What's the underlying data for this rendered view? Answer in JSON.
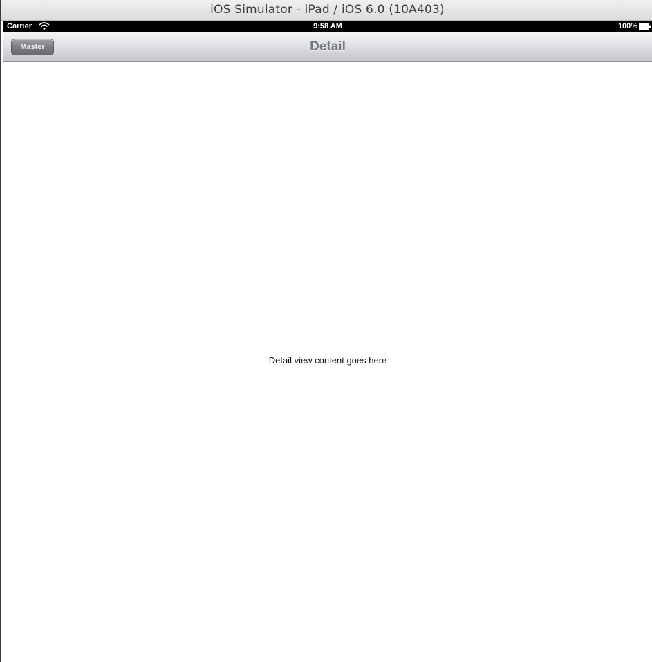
{
  "window": {
    "title": "iOS Simulator - iPad / iOS 6.0 (10A403)"
  },
  "status_bar": {
    "carrier": "Carrier",
    "time": "9:58 AM",
    "battery": "100%",
    "icons": [
      "wifi-icon",
      "battery-icon"
    ]
  },
  "nav_bar": {
    "back_button_label": "Master",
    "title": "Detail"
  },
  "content": {
    "label": "Detail view content goes here"
  },
  "colors": {
    "status_bar_bg": "#000000",
    "nav_title": "#737780",
    "master_button": "#7b7d83",
    "content_bg": "#ffffff"
  }
}
